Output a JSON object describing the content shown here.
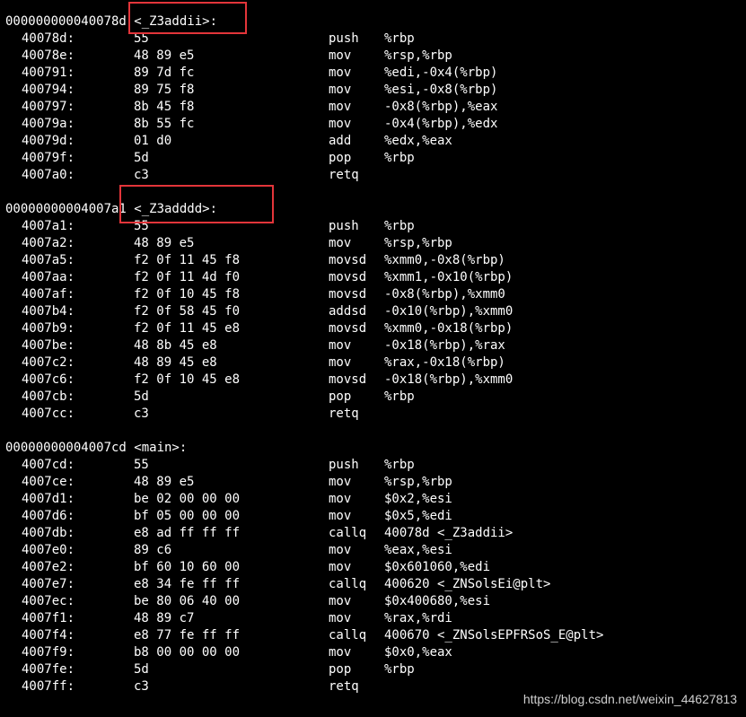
{
  "colors": {
    "background": "#000000",
    "text": "#ffffff",
    "highlight_box": "#e3353a",
    "watermark": "#cfcfcf"
  },
  "functions": [
    {
      "header": "000000000040078d <_Z3addii>:",
      "rows": [
        {
          "addr": "40078d:",
          "bytes": "55",
          "mnemonic": "push",
          "operands": "%rbp"
        },
        {
          "addr": "40078e:",
          "bytes": "48 89 e5",
          "mnemonic": "mov",
          "operands": "%rsp,%rbp"
        },
        {
          "addr": "400791:",
          "bytes": "89 7d fc",
          "mnemonic": "mov",
          "operands": "%edi,-0x4(%rbp)"
        },
        {
          "addr": "400794:",
          "bytes": "89 75 f8",
          "mnemonic": "mov",
          "operands": "%esi,-0x8(%rbp)"
        },
        {
          "addr": "400797:",
          "bytes": "8b 45 f8",
          "mnemonic": "mov",
          "operands": "-0x8(%rbp),%eax"
        },
        {
          "addr": "40079a:",
          "bytes": "8b 55 fc",
          "mnemonic": "mov",
          "operands": "-0x4(%rbp),%edx"
        },
        {
          "addr": "40079d:",
          "bytes": "01 d0",
          "mnemonic": "add",
          "operands": "%edx,%eax"
        },
        {
          "addr": "40079f:",
          "bytes": "5d",
          "mnemonic": "pop",
          "operands": "%rbp"
        },
        {
          "addr": "4007a0:",
          "bytes": "c3",
          "mnemonic": "retq",
          "operands": ""
        }
      ]
    },
    {
      "header": "00000000004007a1 <_Z3adddd>:",
      "rows": [
        {
          "addr": "4007a1:",
          "bytes": "55",
          "mnemonic": "push",
          "operands": "%rbp"
        },
        {
          "addr": "4007a2:",
          "bytes": "48 89 e5",
          "mnemonic": "mov",
          "operands": "%rsp,%rbp"
        },
        {
          "addr": "4007a5:",
          "bytes": "f2 0f 11 45 f8",
          "mnemonic": "movsd",
          "operands": "%xmm0,-0x8(%rbp)"
        },
        {
          "addr": "4007aa:",
          "bytes": "f2 0f 11 4d f0",
          "mnemonic": "movsd",
          "operands": "%xmm1,-0x10(%rbp)"
        },
        {
          "addr": "4007af:",
          "bytes": "f2 0f 10 45 f8",
          "mnemonic": "movsd",
          "operands": "-0x8(%rbp),%xmm0"
        },
        {
          "addr": "4007b4:",
          "bytes": "f2 0f 58 45 f0",
          "mnemonic": "addsd",
          "operands": "-0x10(%rbp),%xmm0"
        },
        {
          "addr": "4007b9:",
          "bytes": "f2 0f 11 45 e8",
          "mnemonic": "movsd",
          "operands": "%xmm0,-0x18(%rbp)"
        },
        {
          "addr": "4007be:",
          "bytes": "48 8b 45 e8",
          "mnemonic": "mov",
          "operands": "-0x18(%rbp),%rax"
        },
        {
          "addr": "4007c2:",
          "bytes": "48 89 45 e8",
          "mnemonic": "mov",
          "operands": "%rax,-0x18(%rbp)"
        },
        {
          "addr": "4007c6:",
          "bytes": "f2 0f 10 45 e8",
          "mnemonic": "movsd",
          "operands": "-0x18(%rbp),%xmm0"
        },
        {
          "addr": "4007cb:",
          "bytes": "5d",
          "mnemonic": "pop",
          "operands": "%rbp"
        },
        {
          "addr": "4007cc:",
          "bytes": "c3",
          "mnemonic": "retq",
          "operands": ""
        }
      ]
    },
    {
      "header": "00000000004007cd <main>:",
      "rows": [
        {
          "addr": "4007cd:",
          "bytes": "55",
          "mnemonic": "push",
          "operands": "%rbp"
        },
        {
          "addr": "4007ce:",
          "bytes": "48 89 e5",
          "mnemonic": "mov",
          "operands": "%rsp,%rbp"
        },
        {
          "addr": "4007d1:",
          "bytes": "be 02 00 00 00",
          "mnemonic": "mov",
          "operands": "$0x2,%esi"
        },
        {
          "addr": "4007d6:",
          "bytes": "bf 05 00 00 00",
          "mnemonic": "mov",
          "operands": "$0x5,%edi"
        },
        {
          "addr": "4007db:",
          "bytes": "e8 ad ff ff ff",
          "mnemonic": "callq",
          "operands": "40078d <_Z3addii>"
        },
        {
          "addr": "4007e0:",
          "bytes": "89 c6",
          "mnemonic": "mov",
          "operands": "%eax,%esi"
        },
        {
          "addr": "4007e2:",
          "bytes": "bf 60 10 60 00",
          "mnemonic": "mov",
          "operands": "$0x601060,%edi"
        },
        {
          "addr": "4007e7:",
          "bytes": "e8 34 fe ff ff",
          "mnemonic": "callq",
          "operands": "400620 <_ZNSolsEi@plt>"
        },
        {
          "addr": "4007ec:",
          "bytes": "be 80 06 40 00",
          "mnemonic": "mov",
          "operands": "$0x400680,%esi"
        },
        {
          "addr": "4007f1:",
          "bytes": "48 89 c7",
          "mnemonic": "mov",
          "operands": "%rax,%rdi"
        },
        {
          "addr": "4007f4:",
          "bytes": "e8 77 fe ff ff",
          "mnemonic": "callq",
          "operands": "400670 <_ZNSolsEPFRSoS_E@plt>"
        },
        {
          "addr": "4007f9:",
          "bytes": "b8 00 00 00 00",
          "mnemonic": "mov",
          "operands": "$0x0,%eax"
        },
        {
          "addr": "4007fe:",
          "bytes": "5d",
          "mnemonic": "pop",
          "operands": "%rbp"
        },
        {
          "addr": "4007ff:",
          "bytes": "c3",
          "mnemonic": "retq",
          "operands": ""
        }
      ]
    }
  ],
  "watermark": "https://blog.csdn.net/weixin_44627813"
}
